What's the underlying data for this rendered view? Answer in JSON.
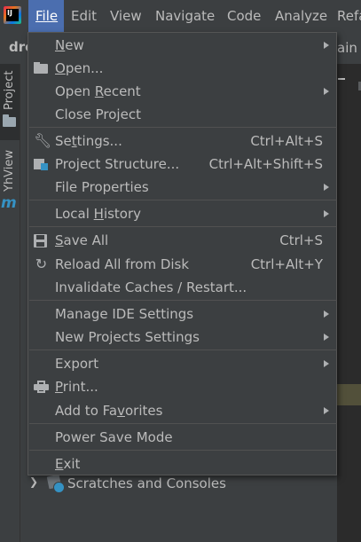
{
  "menubar": {
    "items": [
      "File",
      "Edit",
      "View",
      "Navigate",
      "Code",
      "Analyze",
      "Refa"
    ],
    "active": "File"
  },
  "toolbar": {
    "project_name": "dro",
    "branch_fragment": "ain"
  },
  "side_tools": {
    "project": "Project",
    "yhview": "YhView",
    "m_icon": "m"
  },
  "file_menu": {
    "new": {
      "label": "New",
      "mnemonic_prefix": "",
      "mnemonic": "N",
      "rest": "ew"
    },
    "open": {
      "label": "Open...",
      "mnemonic_prefix": "",
      "mnemonic": "O",
      "rest": "pen..."
    },
    "open_recent": {
      "label": "Open Recent",
      "mnemonic_prefix": "Open ",
      "mnemonic": "R",
      "rest": "ecent"
    },
    "close_project": {
      "label": "Close Project"
    },
    "settings": {
      "label": "Settings...",
      "mnemonic_prefix": "Se",
      "mnemonic": "t",
      "rest": "tings...",
      "shortcut": "Ctrl+Alt+S"
    },
    "project_structure": {
      "label": "Project Structure...",
      "shortcut": "Ctrl+Alt+Shift+S"
    },
    "file_properties": {
      "label": "File Properties"
    },
    "local_history": {
      "label": "Local History",
      "mnemonic_prefix": "Local ",
      "mnemonic": "H",
      "rest": "istory"
    },
    "save_all": {
      "label": "Save All",
      "mnemonic_prefix": "",
      "mnemonic": "S",
      "rest": "ave All",
      "shortcut": "Ctrl+S"
    },
    "reload_all": {
      "label": "Reload All from Disk",
      "shortcut": "Ctrl+Alt+Y"
    },
    "invalidate_caches": {
      "label": "Invalidate Caches / Restart..."
    },
    "manage_ide_settings": {
      "label": "Manage IDE Settings"
    },
    "new_projects_settings": {
      "label": "New Projects Settings"
    },
    "export": {
      "label": "Export"
    },
    "print": {
      "label": "Print...",
      "mnemonic_prefix": "",
      "mnemonic": "P",
      "rest": "rint..."
    },
    "add_to_favorites": {
      "label": "Add to Favorites",
      "mnemonic_prefix": "Add to Fa",
      "mnemonic": "v",
      "rest": "orites"
    },
    "power_save_mode": {
      "label": "Power Save Mode"
    },
    "exit": {
      "label": "Exit",
      "mnemonic_prefix": "",
      "mnemonic": "E",
      "rest": "xit"
    }
  },
  "project_tree": {
    "scratches": "Scratches and Consoles"
  },
  "colors": {
    "menu_bg": "#3c3f41",
    "active": "#4b6eaf",
    "text": "#bbbbbb",
    "accent": "#3592c4"
  }
}
